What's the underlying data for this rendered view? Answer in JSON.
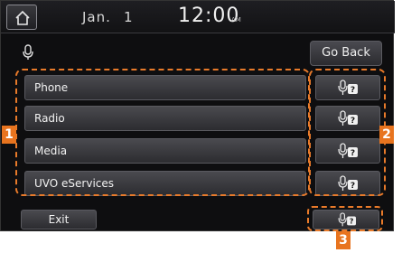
{
  "colors": {
    "screen_background": "#0e0e10",
    "button_gradient_top": "#4a4a4f",
    "button_gradient_bottom": "#2c2c30",
    "callout_orange": "#e8741f",
    "dashed_outline": "#e87a2a"
  },
  "statusbar": {
    "home_icon": "home-icon",
    "date_month": "Jan.",
    "date_day": "1",
    "time": "12:00",
    "ampm": "AM"
  },
  "header": {
    "mic_icon": "microphone-icon",
    "go_back_label": "Go Back"
  },
  "list": {
    "items": [
      {
        "label": "Phone"
      },
      {
        "label": "Radio"
      },
      {
        "label": "Media"
      },
      {
        "label": "UVO eServices"
      }
    ]
  },
  "help_buttons": {
    "icon": "voice-help-icon",
    "count": 4
  },
  "footer": {
    "exit_label": "Exit",
    "help_icon": "voice-help-icon"
  },
  "callouts": [
    "1",
    "2",
    "3"
  ]
}
